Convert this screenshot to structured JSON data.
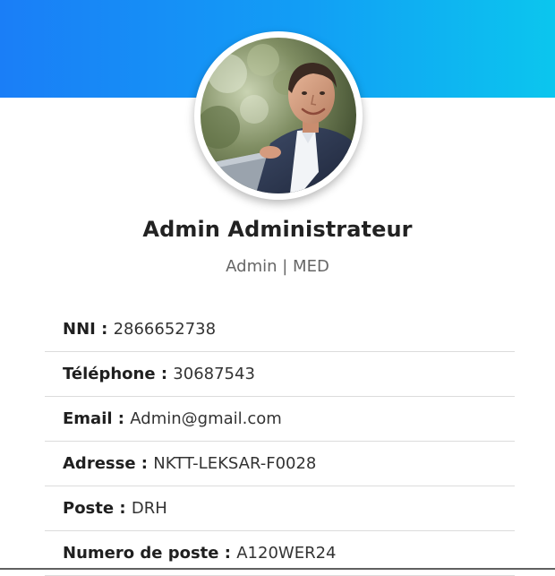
{
  "header": {
    "gradient_start": "#1a7ef7",
    "gradient_end": "#0bc6ee"
  },
  "profile": {
    "avatar_icon": "user-photo",
    "name": "Admin Administrateur",
    "role_line": "Admin | MED"
  },
  "info": [
    {
      "label": "NNI :",
      "value": "2866652738"
    },
    {
      "label": "Téléphone :",
      "value": "30687543"
    },
    {
      "label": "Email :",
      "value": "Admin@gmail.com"
    },
    {
      "label": "Adresse :",
      "value": "NKTT-LEKSAR-F0028"
    },
    {
      "label": "Poste :",
      "value": "DRH"
    },
    {
      "label": "Numero de poste :",
      "value": "A120WER24"
    }
  ]
}
